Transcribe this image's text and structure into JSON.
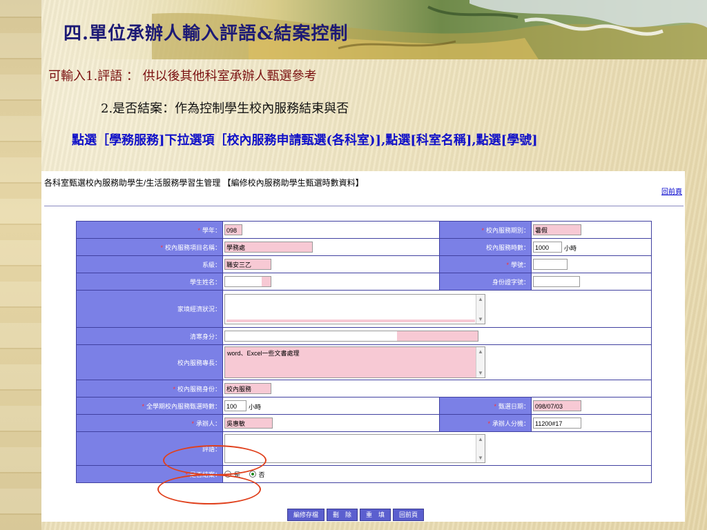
{
  "slide": {
    "title": "四.單位承辦人輸入評語&結案控制",
    "line1": "可輸入1.評語 ： 供以後其他科室承辦人甄選參考",
    "line2": "2.是否結案：作為控制學生校內服務結束與否",
    "line3": "點選［學務服務]下拉選項［校內服務申請甄選(各科室)],點選[科室名稱],點選[學號]"
  },
  "screen": {
    "header": "各科室甄選校內服務助學生/生活服務學習生管理 【編修校內服務助學生甄選時數資料】",
    "back_link": "回前頁",
    "fields": {
      "year_label": "學年：",
      "year_value": "098",
      "period_label": "校內服務期別：",
      "period_value": "暑假",
      "item_label": "校內服務項目名稱：",
      "item_value": "學務處",
      "hours_label": "校內服務時數：",
      "hours_value": "1000",
      "hours_unit": "小時",
      "dept_label": "系級：",
      "dept_value": "職安三乙",
      "student_id_label": "學號：",
      "student_id_value": "",
      "name_label": "學生姓名：",
      "name_value": "",
      "id_no_label": "身份證字號：",
      "id_no_value": "",
      "family_label": "家境經濟狀況：",
      "family_value": "",
      "poor_label": "清寒身分：",
      "poor_value": "",
      "skill_label": "校內服務專長：",
      "skill_value": "word、Excel一些文書處理",
      "role_label": "校內服務身份：",
      "role_value": "校內服務",
      "sem_hours_label": "全學期校內服務甄選時數：",
      "sem_hours_value": "100",
      "sem_hours_unit": "小時",
      "select_date_label": "甄選日期：",
      "select_date_value": "098/07/03",
      "handler_label": "承辦人：",
      "handler_value": "吳惠敏",
      "ext_label": "承辦人分機：",
      "ext_value": "11200#17",
      "comment_label": "評語：",
      "comment_value": "",
      "closed_label": "是否結案：",
      "closed_yes": "是",
      "closed_no": "否",
      "closed_selected": "否"
    },
    "buttons": {
      "save": "編修存檔",
      "delete": "刪　除",
      "reset": "重　填",
      "back": "回前頁"
    }
  },
  "colors": {
    "title": "#1d1a75",
    "label_bg": "#7b80e6",
    "required": "#ff3030",
    "pink_field": "#f7c9d4",
    "highlight_oval": "#e0401c"
  }
}
